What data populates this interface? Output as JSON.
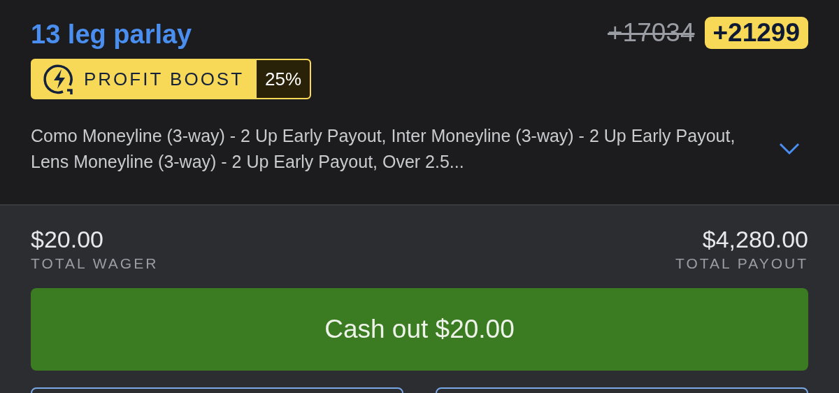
{
  "bet": {
    "title": "13 leg parlay",
    "original_odds": "+17034",
    "boosted_odds": "+21299",
    "boost": {
      "label": "PROFIT BOOST",
      "percent": "25%"
    },
    "legs_summary": "Como Moneyline (3-way) - 2 Up Early Payout, Inter Moneyline (3-way) - 2 Up Early Payout, Lens Moneyline (3-way) - 2 Up Early Payout, Over 2.5...",
    "expanded": false
  },
  "totals": [
    {
      "amount": "$20.00",
      "label": "TOTAL WAGER"
    },
    {
      "amount": "$4,280.00",
      "label": "TOTAL PAYOUT"
    }
  ],
  "cash_out": {
    "label": "Cash out $20.00"
  }
}
